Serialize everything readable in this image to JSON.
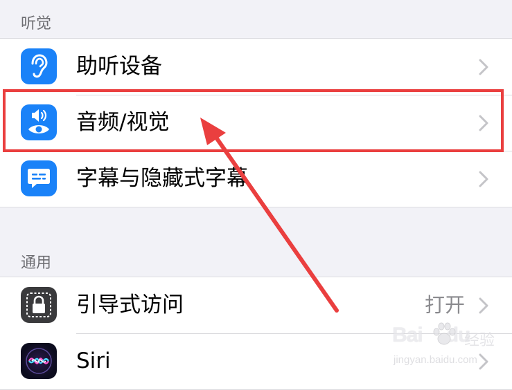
{
  "sections": {
    "hearing": {
      "header": "听觉",
      "items": [
        {
          "label": "助听设备",
          "icon": "ear-icon"
        },
        {
          "label": "音频/视觉",
          "icon": "speaker-eye-icon"
        },
        {
          "label": "字幕与隐藏式字幕",
          "icon": "caption-bubble-icon"
        }
      ]
    },
    "general": {
      "header": "通用",
      "items": [
        {
          "label": "引导式访问",
          "value": "打开",
          "icon": "lock-icon"
        },
        {
          "label": "Siri",
          "icon": "siri-icon"
        }
      ]
    }
  },
  "watermark": {
    "brand": "Bai",
    "brand_suffix": "du",
    "sub": "经验",
    "url": "jingyan.baidu.com"
  },
  "colors": {
    "icon_blue": "#1a82f8",
    "highlight_red": "#ea3f3f",
    "background": "#f2f2f7",
    "secondary_text": "#8a8a8e"
  }
}
